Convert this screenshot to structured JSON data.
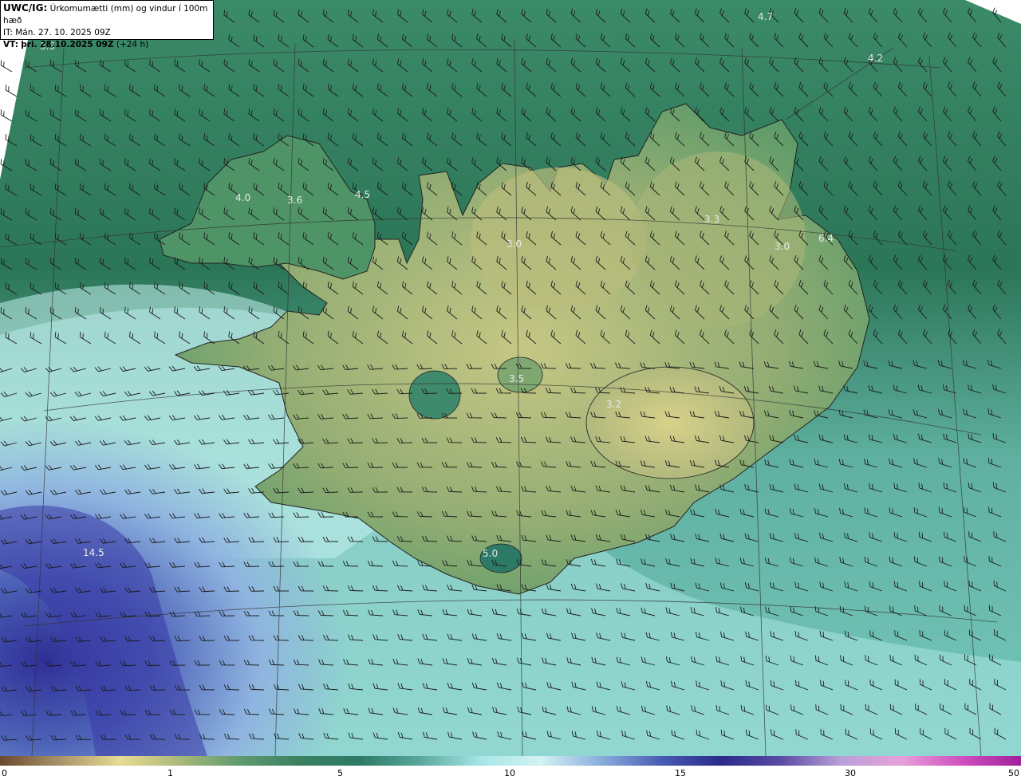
{
  "header": {
    "title_prefix": "UWC/IG:",
    "title_text": "Úrkomumætti (mm) og vindur í 100m hæð",
    "it_line": "IT: Mán. 27. 10. 2025 09Z",
    "vt_prefix": "VT:",
    "vt_text": "þri. 28.10.2025 09Z",
    "vt_suffix": "(+24 h)"
  },
  "value_labels": [
    "3.5",
    "4.7",
    "4.2",
    "4.0",
    "3.6",
    "4.5",
    "3.3",
    "3.0",
    "3.0",
    "6.4",
    "3.5",
    "3.2",
    "5.0",
    "14.5"
  ],
  "colorbar": {
    "ticks": [
      "0",
      "1",
      "5",
      "10",
      "15",
      "30",
      "50"
    ],
    "colors": [
      "#6b4a2f",
      "#a8936a",
      "#e7dc92",
      "#a9b87a",
      "#5f9a6e",
      "#3a8060",
      "#2c7a66",
      "#5aa89c",
      "#a6e6e6",
      "#d4f2f2",
      "#8aaedc",
      "#4a5cb4",
      "#2a2a8a",
      "#5a4aa4",
      "#b8a0d8",
      "#e8a0d8",
      "#d050c0",
      "#a0209a"
    ]
  },
  "colors": {
    "sea_dark": "#2a6e56",
    "land_low": "#5d9e6a",
    "land_high": "#c9c884",
    "wet_band": "#b8ecec",
    "heavy": "#3a3aa0"
  }
}
